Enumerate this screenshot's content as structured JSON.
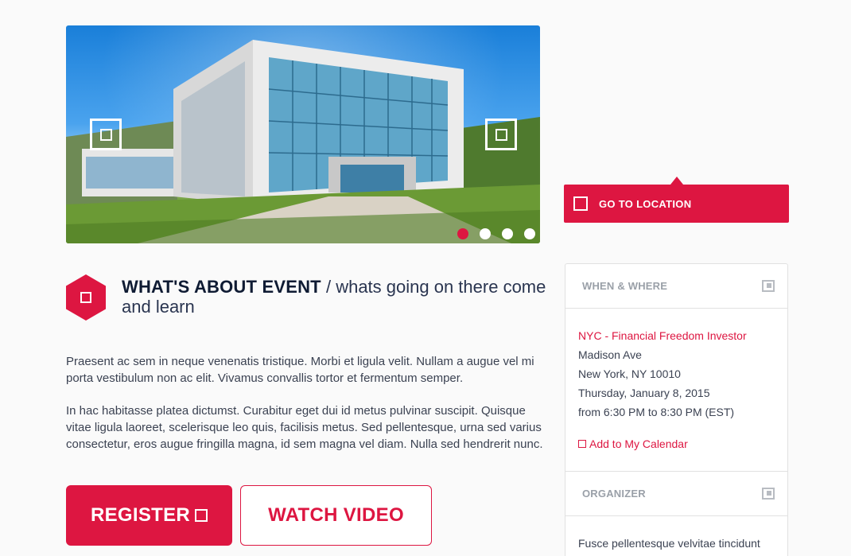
{
  "location_button": {
    "label": "GO TO LOCATION",
    "icon": "square-icon"
  },
  "event": {
    "title_bold": "WHAT'S ABOUT EVENT",
    "title_slash": "/",
    "title_light": "whats going on there come and learn",
    "paragraph1": "Praesent ac sem in neque venenatis tristique. Morbi et ligula velit. Nullam a augue vel mi porta vestibulum non ac elit. Vivamus convallis tortor et fermentum semper.",
    "paragraph2": "In hac habitasse platea dictumst. Curabitur eget dui id metus pulvinar suscipit. Quisque vitae ligula laoreet, scelerisque leo quis, facilisis metus. Sed pellentesque, urna sed varius consectetur, eros augue fringilla magna, id sem magna vel diam. Nulla sed hendrerit nunc."
  },
  "buttons": {
    "register": "REGISTER",
    "watch": "WATCH VIDEO"
  },
  "slider": {
    "dots": 4,
    "active_dot": 1
  },
  "when_where": {
    "title": "WHEN & WHERE",
    "venue": "NYC - Financial Freedom Investor",
    "street": "Madison Ave",
    "city": "New York, NY 10010",
    "date": "Thursday, January 8, 2015",
    "time": "from 6:30 PM to 8:30 PM (EST)",
    "calendar_link": "Add to My Calendar"
  },
  "organizer": {
    "title": "ORGANIZER",
    "text": "Fusce pellentesque velvitae tincidunt"
  },
  "colors": {
    "accent": "#dd1641",
    "dark": "#0f1b33",
    "background": "#fafafa"
  }
}
